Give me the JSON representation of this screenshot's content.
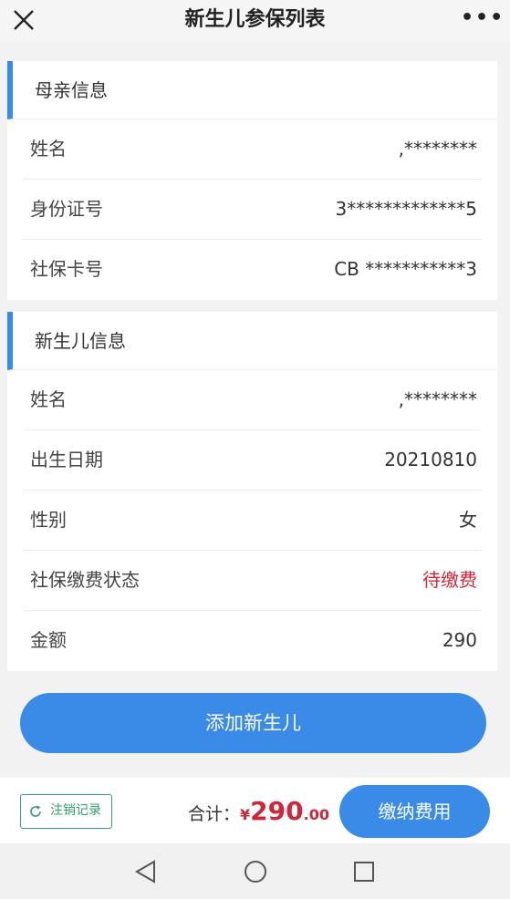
{
  "header": {
    "title": "新生儿参保列表",
    "more_label": "•••"
  },
  "mother": {
    "section_title": "母亲信息",
    "rows": [
      {
        "label": "姓名",
        "value": ",********"
      },
      {
        "label": "身份证号",
        "value": "3*************5"
      },
      {
        "label": "社保卡号",
        "value": "CB ***********3"
      }
    ]
  },
  "newborn": {
    "section_title": "新生儿信息",
    "rows": [
      {
        "label": "姓名",
        "value": ",********"
      },
      {
        "label": "出生日期",
        "value": "20210810"
      },
      {
        "label": "性别",
        "value": "女"
      },
      {
        "label": "社保缴费状态",
        "value": "待缴费"
      },
      {
        "label": "金额",
        "value": "290"
      }
    ]
  },
  "add_button": "添加新生儿",
  "footer": {
    "cancel_record": "注销记录",
    "total_label": "合计：",
    "currency": "¥",
    "total_integer": "290",
    "total_decimal": ".00",
    "pay_button": "缴纳费用"
  },
  "colors": {
    "accent": "#3a8be8",
    "status_pending": "#d0263a",
    "cancel_green": "#2fa26b"
  },
  "icons": {
    "close": "close-icon",
    "more": "more-dots-icon",
    "refresh": "refresh-icon",
    "back": "back-triangle-icon",
    "home": "home-circle-icon",
    "recent": "recent-square-icon"
  }
}
